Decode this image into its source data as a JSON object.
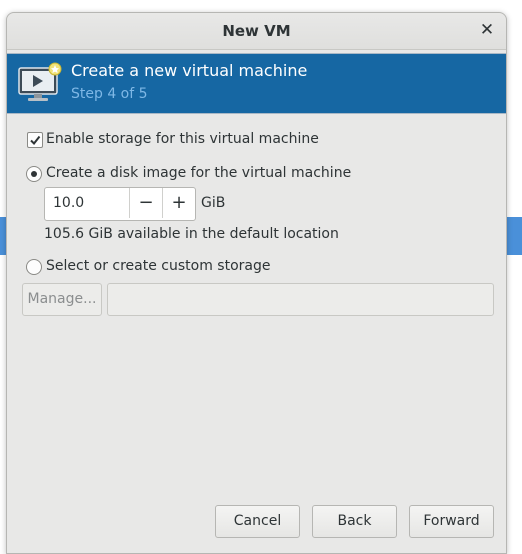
{
  "window": {
    "title": "New VM",
    "close_icon": "close-icon"
  },
  "header": {
    "title": "Create a new virtual machine",
    "step": "Step 4 of 5",
    "icon": "vm-icon",
    "bg_color": "#1667a3"
  },
  "storage": {
    "enable_label": "Enable storage for this virtual machine",
    "enable_checked": true,
    "create_disk_label": "Create a disk image for the virtual machine",
    "create_disk_selected": true,
    "size_value": "10.0",
    "decrement_label": "−",
    "increment_label": "+",
    "size_unit": "GiB",
    "available_text": "105.6 GiB available in the default location",
    "custom_label": "Select or create custom storage",
    "custom_selected": false,
    "manage_label": "Manage...",
    "custom_path_value": ""
  },
  "footer": {
    "cancel_label": "Cancel",
    "back_label": "Back",
    "forward_label": "Forward"
  }
}
